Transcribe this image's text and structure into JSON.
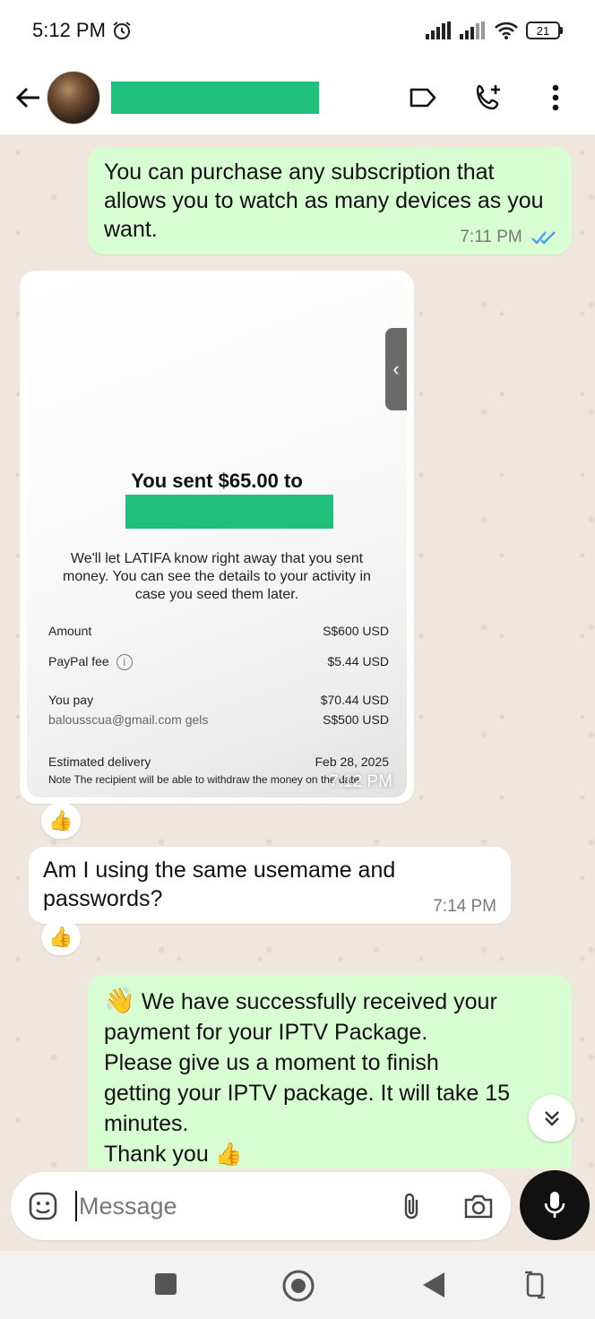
{
  "status_bar": {
    "time": "5:12 PM",
    "battery": "21"
  },
  "header": {
    "contact_name_redacted": true
  },
  "messages": [
    {
      "direction": "out",
      "text": "You can purchase any subscription that allows you to watch as many devices as you want.",
      "time": "7:11 PM",
      "status": "read"
    },
    {
      "direction": "in",
      "type": "image",
      "time": "7:12 PM",
      "receipt": {
        "title": "You sent $65.00 to",
        "notice": "We'll let LATIFA know right away that you sent money. You can see the details to your activity in case you seed them later.",
        "rows": [
          {
            "label": "Amount",
            "value": "S$600 USD"
          },
          {
            "label": "PayPal fee",
            "value": "$5.44 USD"
          },
          {
            "label": "You pay",
            "value": "$70.44 USD"
          },
          {
            "label": "balousscua@gmail.com gels",
            "value": "S$500 USD"
          },
          {
            "label": "Estimated delivery",
            "value": "Feb 28, 2025"
          }
        ],
        "note": "Note The recipient will be able to withdraw the money on the date"
      },
      "reaction": "👍"
    },
    {
      "direction": "in",
      "text": "Am I using the same usemame and passwords?",
      "time": "7:14 PM",
      "reaction": "👍"
    },
    {
      "direction": "out",
      "emoji": "👋",
      "lines": [
        "We have successfully received your",
        "payment for your IPTV Package.",
        "Please give us a moment to finish",
        "getting your IPTV package. It will take 15",
        "minutes.",
        "Thank you 👍"
      ]
    }
  ],
  "composer": {
    "placeholder": "Message"
  }
}
